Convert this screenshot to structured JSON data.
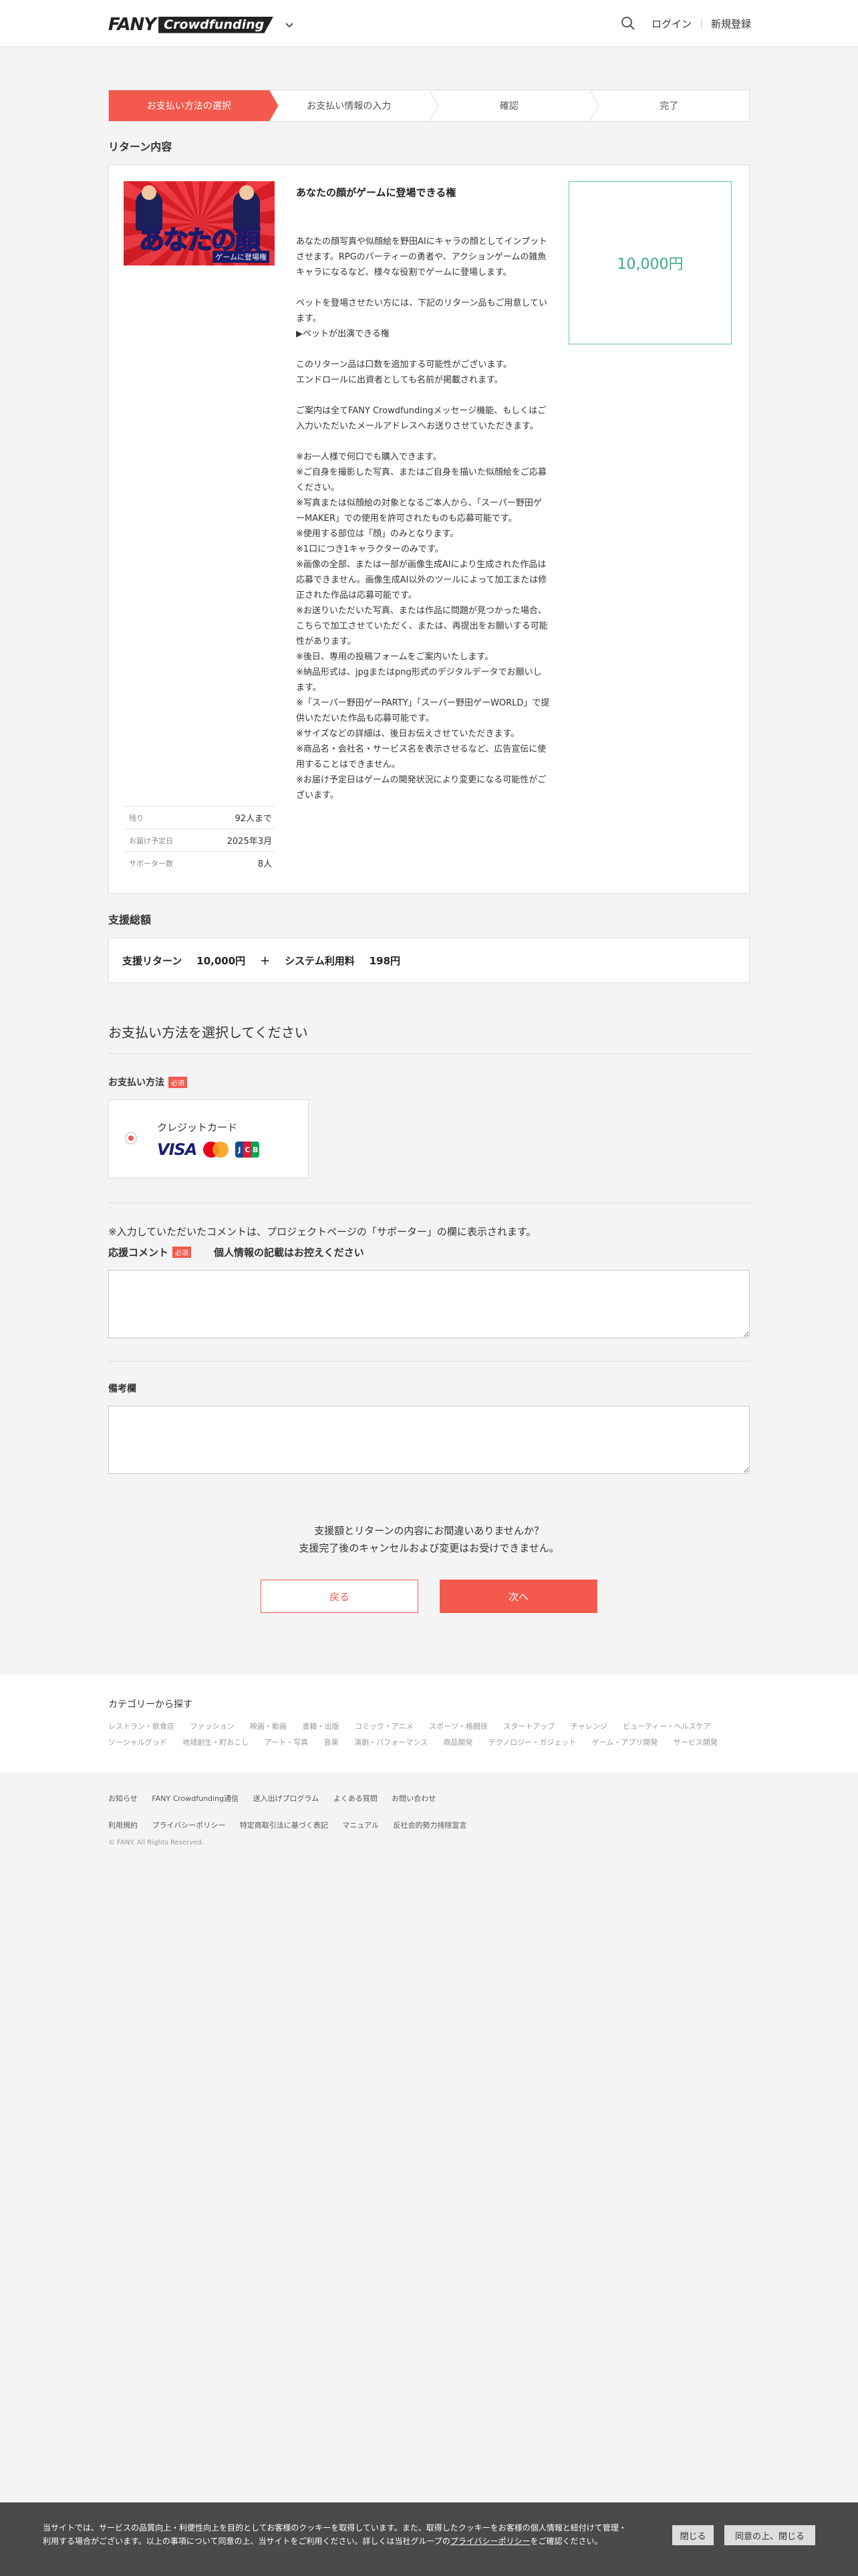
{
  "header": {
    "logo_main": "FANY",
    "logo_sub": "Crowdfunding",
    "login": "ログイン",
    "signup": "新規登録"
  },
  "steps": [
    "お支払い方法の選択",
    "お支払い情報の入力",
    "確認",
    "完了"
  ],
  "return_section": {
    "title": "リターン内容",
    "image_title": "あなたの顔",
    "image_subtitle": "ゲームに登場権",
    "name": "あなたの顔がゲームに登場できる権",
    "description": "あなたの顔写真や似顔絵を野田AIにキャラの顔としてインプットさせます。RPGのパーティーの勇者や、アクションゲームの雑魚キャラになるなど、様々な役割でゲームに登場します。\n\nペットを登場させたい方には、下記のリターン品もご用意しています。\n▶ペットが出演できる権\n\nこのリターン品は口数を追加する可能性がございます。\nエンドロールに出資者としても名前が掲載されます。\n\nご案内は全てFANY Crowdfundingメッセージ機能、もしくはご入力いただいたメールアドレスへお送りさせていただきます。\n\n※お一人様で何口でも購入できます。\n※ご自身を撮影した写真、またはご自身を描いた似顔絵をご応募ください。\n※写真または似顔絵の対象となるご本人から、「スーパー野田ゲーMAKER」での使用を許可されたものも応募可能です。\n※使用する部位は「顔」のみとなります。\n※1口につき1キャラクターのみです。\n※画像の全部、または一部が画像生成AIにより生成された作品は応募できません。画像生成AI以外のツールによって加工または修正された作品は応募可能です。\n※お送りいただいた写真、または作品に問題が見つかった場合、こちらで加工させていただく、または、再提出をお願いする可能性があります。\n※後日、専用の投稿フォームをご案内いたします。\n※納品形式は、jpgまたはpng形式のデジタルデータでお願いします。\n※「スーパー野田ゲーPARTY」「スーパー野田ゲーWORLD」で提供いただいた作品も応募可能です。\n※サイズなどの詳細は、後日お伝えさせていただきます。\n※商品名・会社名・サービス名を表示させるなど、広告宣伝に使用することはできません。\n※お届け予定日はゲームの開発状況により変更になる可能性がございます。",
    "price": "10,000円",
    "meta": [
      {
        "key": "残り",
        "value": "92人まで"
      },
      {
        "key": "お届け予定日",
        "value": "2025年3月"
      },
      {
        "key": "サポーター数",
        "value": "8人"
      }
    ]
  },
  "total_section": {
    "title": "支援総額",
    "return_label": "支援リターン",
    "return_amount": "10,000円",
    "plus": "＋",
    "fee_label": "システム利用料",
    "fee_amount": "198円"
  },
  "payment": {
    "heading": "お支払い方法を選択してください",
    "label": "お支払い方法",
    "required": "必須",
    "card_label": "クレジットカード",
    "brands": [
      "VISA",
      "Mastercard",
      "JCB"
    ]
  },
  "comment": {
    "note": "※入力していただいたコメントは、プロジェクトページの「サポーター」の欄に表示されます。",
    "label": "応援コメント",
    "required": "必須",
    "warning": "個人情報の記載はお控えください"
  },
  "remarks": {
    "label": "備考欄"
  },
  "confirm_text": [
    "支援額とリターンの内容にお間違いありませんか？",
    "支援完了後のキャンセルおよび変更はお受けできません。"
  ],
  "buttons": {
    "back": "戻る",
    "next": "次へ"
  },
  "footer": {
    "category_title": "カテゴリーから探す",
    "categories": [
      "レストラン・飲食店",
      "ファッション",
      "映画・動画",
      "書籍・出版",
      "コミック・アニメ",
      "スポーツ・格闘技",
      "スタートアップ",
      "チャレンジ",
      "ビューティー・ヘルスケア",
      "ソーシャルグッド",
      "地域創生・町おこし",
      "アート・写真",
      "音楽",
      "演劇・パフォーマンス",
      "商品開発",
      "テクノロジー・ガジェット",
      "ゲーム・アプリ開発",
      "サービス開発"
    ],
    "links_row1": [
      "お知らせ",
      "FANY Crowdfunding通信",
      "送入出げプログラム",
      "よくある質問",
      "お問い合わせ"
    ],
    "links_row2": [
      "利用規約",
      "プライバシーポリシー",
      "特定商取引法に基づく表記",
      "マニュアル",
      "反社会的勢力排除宣言"
    ],
    "copyright": "© FANY. All Rights Reserved."
  },
  "cookie": {
    "text": "当サイトでは、サービスの品質向上・利便性向上を目的としてお客様のクッキーを取得しています。また、取得したクッキーをお客様の個人情報と紐付けて管理・利用する場合がございます。以上の事項について同意の上、当サイトをご利用ください。詳しくは当社グループの",
    "link": "プライバシーポリシー",
    "text_after": "をご確認ください。",
    "close": "閉じる",
    "agree_close": "同意の上、閉じる"
  },
  "colors": {
    "accent": "#f4594d",
    "price_green": "#3aa888"
  }
}
